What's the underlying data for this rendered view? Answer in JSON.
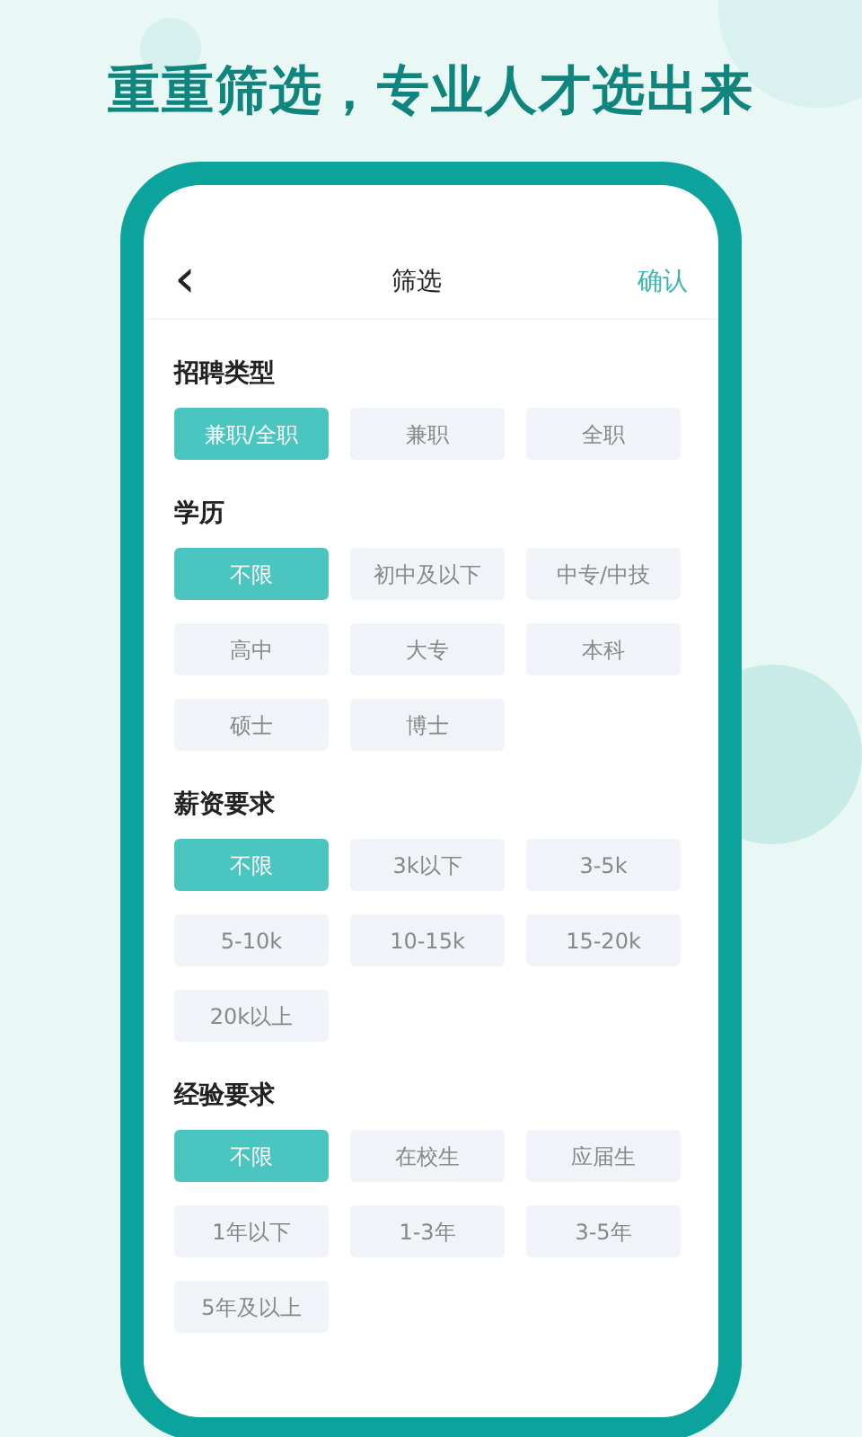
{
  "headline": "重重筛选，专业人才选出来",
  "nav": {
    "back": "‹",
    "title": "筛选",
    "action": "确认"
  },
  "sections": [
    {
      "title": "招聘类型",
      "options": [
        {
          "label": "兼职/全职",
          "selected": true
        },
        {
          "label": "兼职",
          "selected": false
        },
        {
          "label": "全职",
          "selected": false
        }
      ]
    },
    {
      "title": "学历",
      "options": [
        {
          "label": "不限",
          "selected": true
        },
        {
          "label": "初中及以下",
          "selected": false
        },
        {
          "label": "中专/中技",
          "selected": false
        },
        {
          "label": "高中",
          "selected": false
        },
        {
          "label": "大专",
          "selected": false
        },
        {
          "label": "本科",
          "selected": false
        },
        {
          "label": "硕士",
          "selected": false
        },
        {
          "label": "博士",
          "selected": false
        }
      ]
    },
    {
      "title": "薪资要求",
      "options": [
        {
          "label": "不限",
          "selected": true
        },
        {
          "label": "3k以下",
          "selected": false
        },
        {
          "label": "3-5k",
          "selected": false
        },
        {
          "label": "5-10k",
          "selected": false
        },
        {
          "label": "10-15k",
          "selected": false
        },
        {
          "label": "15-20k",
          "selected": false
        },
        {
          "label": "20k以上",
          "selected": false
        }
      ]
    },
    {
      "title": "经验要求",
      "options": [
        {
          "label": "不限",
          "selected": true
        },
        {
          "label": "在校生",
          "selected": false
        },
        {
          "label": "应届生",
          "selected": false
        },
        {
          "label": "1年以下",
          "selected": false
        },
        {
          "label": "1-3年",
          "selected": false
        },
        {
          "label": "3-5年",
          "selected": false
        },
        {
          "label": "5年及以上",
          "selected": false
        }
      ]
    }
  ]
}
